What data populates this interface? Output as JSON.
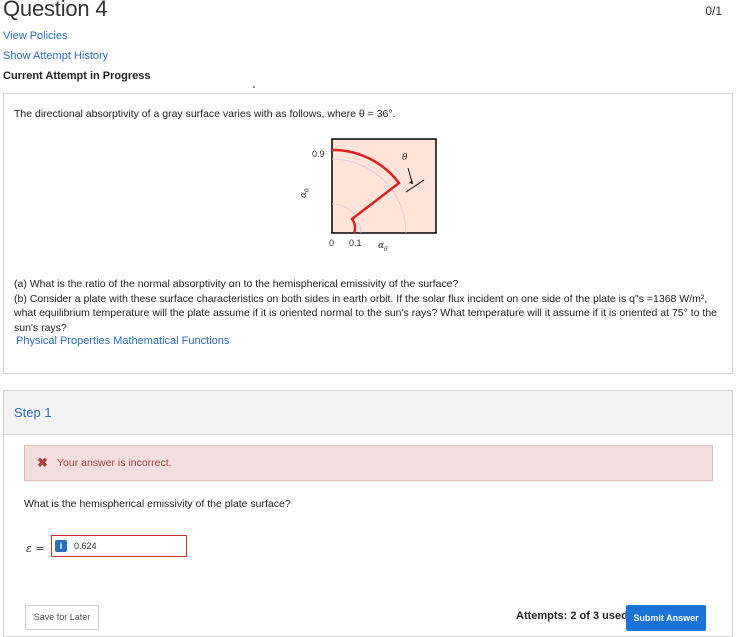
{
  "header": {
    "title": "Question 4",
    "score": "0/1",
    "view_policies": "View Policies",
    "show_attempt_history": "Show Attempt History",
    "current_attempt": "Current Attempt in Progress"
  },
  "problem": {
    "intro": "The directional absorptivity of a gray surface varies with as follows, where θ = 36°.",
    "figure": {
      "y_label": "α",
      "y_label_sub": "θ",
      "tick_top": "0.9",
      "x_tick_0": "0",
      "x_tick_1": "0.1",
      "x_label": "α",
      "x_label_sub": "θ",
      "angle_label": "θ"
    },
    "part_a": "(a) What is the ratio of the normal absorptivity αn to the hemispherical emissivity of the surface?",
    "part_b": "(b) Consider a plate with these surface characteristics on both sides in earth orbit. If the solar flux incident on one side of the plate is q\"s =1368 W/m², what equilibrium temperature will the plate assume if it is oriented normal to the sun's rays? What temperature will it assume if it is oriented at 75° to the sun's rays?",
    "links_label": "Physical Properties Mathematical Functions"
  },
  "step": {
    "title": "Step 1",
    "alert_text": "Your answer is incorrect.",
    "question": "What is the hemispherical emissivity of the plate surface?",
    "symbol_label": "ε =",
    "info_icon_glyph": "i",
    "answer_value": "0.624",
    "save_label": "Save for Later",
    "attempts": "Attempts: 2 of 3 used",
    "submit_label": "Submit Answer"
  },
  "colors": {
    "link": "#2a6ebb",
    "alert_bg": "#f2dede",
    "alert_text": "#a94442",
    "submit_bg": "#1a73d9",
    "figure_fill": "#fde3d8",
    "curve": "#e02020"
  },
  "icons": [
    "close-icon",
    "info-icon",
    "arrow-icon"
  ]
}
